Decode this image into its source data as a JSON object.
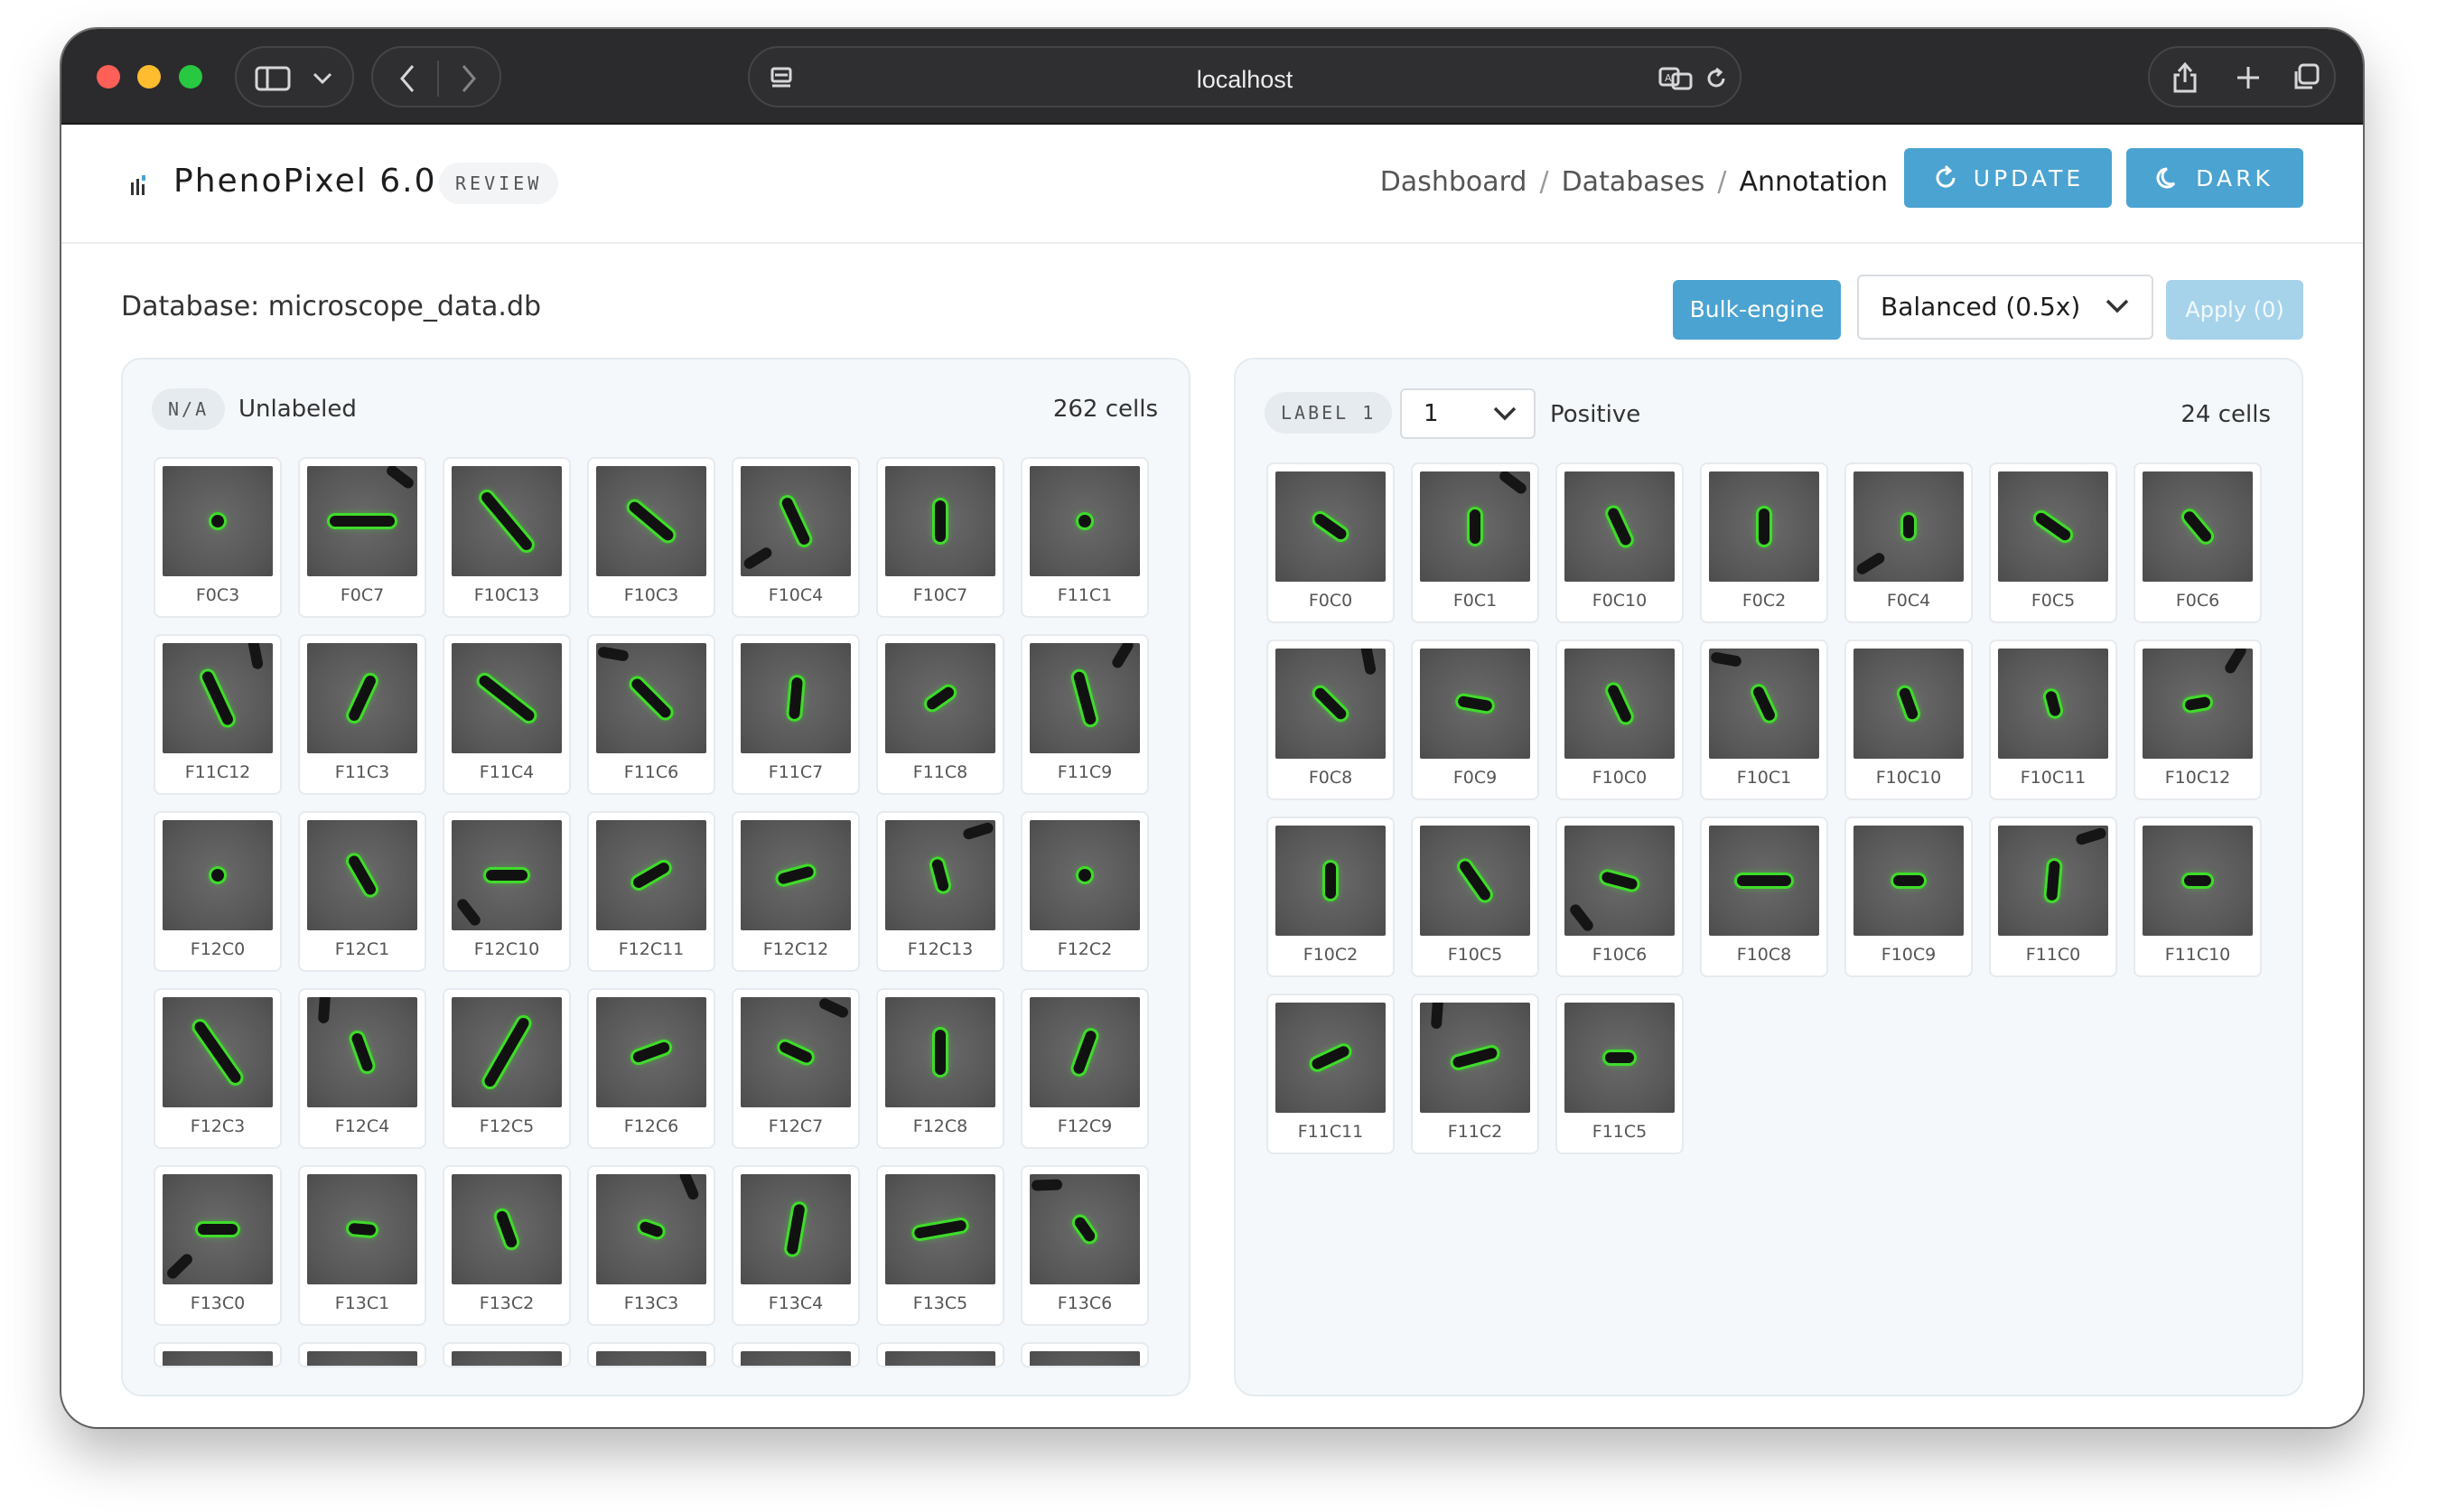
{
  "browser": {
    "address": "localhost"
  },
  "header": {
    "brand": "PhenoPixel 6.0",
    "mode_badge": "REVIEW",
    "breadcrumbs": [
      "Dashboard",
      "Databases",
      "Annotation"
    ],
    "update_label": "UPDATE",
    "dark_label": "DARK",
    "accent_color": "#4ba3d1"
  },
  "toolbar": {
    "database_label": "Database: microscope_data.db",
    "bulk_engine_label": "Bulk-engine",
    "mode_select_value": "Balanced (0.5x)",
    "apply_label": "Apply (0)"
  },
  "unlabeled_panel": {
    "tag": "N/A",
    "title": "Unlabeled",
    "count": "262 cells",
    "cells": [
      {
        "id": "F0C3",
        "angle": -60,
        "len": 10
      },
      {
        "id": "F0C7",
        "angle": 0,
        "len": 72
      },
      {
        "id": "F10C13",
        "angle": 50,
        "len": 80
      },
      {
        "id": "F10C3",
        "angle": 40,
        "len": 60
      },
      {
        "id": "F10C4",
        "angle": 65,
        "len": 56
      },
      {
        "id": "F10C7",
        "angle": 90,
        "len": 46
      },
      {
        "id": "F11C1",
        "angle": 0,
        "len": 10
      },
      {
        "id": "F11C12",
        "angle": 65,
        "len": 64
      },
      {
        "id": "F11C3",
        "angle": -65,
        "len": 54
      },
      {
        "id": "F11C4",
        "angle": 38,
        "len": 74
      },
      {
        "id": "F11C6",
        "angle": 45,
        "len": 56
      },
      {
        "id": "F11C7",
        "angle": -85,
        "len": 46
      },
      {
        "id": "F11C8",
        "angle": -35,
        "len": 34
      },
      {
        "id": "F11C9",
        "angle": 75,
        "len": 60
      },
      {
        "id": "F12C0",
        "angle": -60,
        "len": 12
      },
      {
        "id": "F12C1",
        "angle": 60,
        "len": 48
      },
      {
        "id": "F12C10",
        "angle": 0,
        "len": 46
      },
      {
        "id": "F12C11",
        "angle": -30,
        "len": 44
      },
      {
        "id": "F12C12",
        "angle": -15,
        "len": 40
      },
      {
        "id": "F12C13",
        "angle": 75,
        "len": 36
      },
      {
        "id": "F12C2",
        "angle": 20,
        "len": 14
      },
      {
        "id": "F12C3",
        "angle": 55,
        "len": 80
      },
      {
        "id": "F12C4",
        "angle": 70,
        "len": 44
      },
      {
        "id": "F12C5",
        "angle": -60,
        "len": 86
      },
      {
        "id": "F12C6",
        "angle": -20,
        "len": 42
      },
      {
        "id": "F12C7",
        "angle": 25,
        "len": 38
      },
      {
        "id": "F12C8",
        "angle": 90,
        "len": 50
      },
      {
        "id": "F12C9",
        "angle": -70,
        "len": 50
      },
      {
        "id": "F13C0",
        "angle": 0,
        "len": 44
      },
      {
        "id": "F13C1",
        "angle": 5,
        "len": 30
      },
      {
        "id": "F13C2",
        "angle": 70,
        "len": 42
      },
      {
        "id": "F13C3",
        "angle": 20,
        "len": 26
      },
      {
        "id": "F13C4",
        "angle": -80,
        "len": 56
      },
      {
        "id": "F13C5",
        "angle": -10,
        "len": 58
      },
      {
        "id": "F13C6",
        "angle": 55,
        "len": 30
      }
    ]
  },
  "positive_panel": {
    "tag": "LABEL 1",
    "label_select_value": "1",
    "title": "Positive",
    "count": "24 cells",
    "cells": [
      {
        "id": "F0C0",
        "angle": 35,
        "len": 40
      },
      {
        "id": "F0C1",
        "angle": 90,
        "len": 38
      },
      {
        "id": "F0C10",
        "angle": 65,
        "len": 44
      },
      {
        "id": "F0C2",
        "angle": 90,
        "len": 40
      },
      {
        "id": "F0C4",
        "angle": 90,
        "len": 26
      },
      {
        "id": "F0C5",
        "angle": 35,
        "len": 44
      },
      {
        "id": "F0C6",
        "angle": 50,
        "len": 40
      },
      {
        "id": "F0C8",
        "angle": 45,
        "len": 44
      },
      {
        "id": "F0C9",
        "angle": 10,
        "len": 38
      },
      {
        "id": "F10C0",
        "angle": 65,
        "len": 44
      },
      {
        "id": "F10C1",
        "angle": 65,
        "len": 40
      },
      {
        "id": "F10C10",
        "angle": 70,
        "len": 36
      },
      {
        "id": "F10C11",
        "angle": 75,
        "len": 28
      },
      {
        "id": "F10C12",
        "angle": -10,
        "len": 28
      },
      {
        "id": "F10C2",
        "angle": 90,
        "len": 40
      },
      {
        "id": "F10C5",
        "angle": 55,
        "len": 50
      },
      {
        "id": "F10C6",
        "angle": 15,
        "len": 40
      },
      {
        "id": "F10C8",
        "angle": 0,
        "len": 60
      },
      {
        "id": "F10C9",
        "angle": 0,
        "len": 34
      },
      {
        "id": "F11C0",
        "angle": 95,
        "len": 44
      },
      {
        "id": "F11C10",
        "angle": 0,
        "len": 30
      },
      {
        "id": "F11C11",
        "angle": -25,
        "len": 44
      },
      {
        "id": "F11C2",
        "angle": -15,
        "len": 50
      },
      {
        "id": "F11C5",
        "angle": 0,
        "len": 32
      }
    ]
  }
}
